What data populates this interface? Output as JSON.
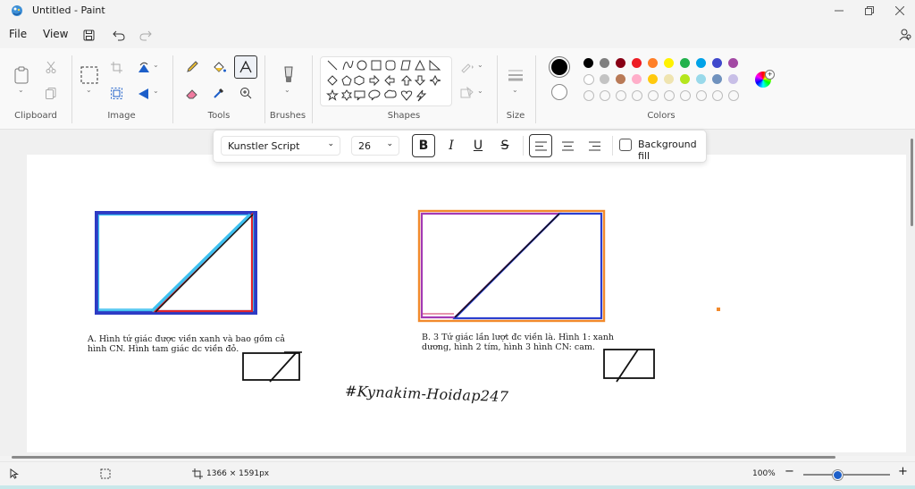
{
  "window": {
    "title": "Untitled - Paint"
  },
  "menu": {
    "file": "File",
    "view": "View"
  },
  "ribbon": {
    "groups": {
      "clipboard": "Clipboard",
      "image": "Image",
      "tools": "Tools",
      "brushes": "Brushes",
      "shapes": "Shapes",
      "size": "Size",
      "colors": "Colors"
    },
    "colors": {
      "row1": [
        "#000000",
        "#7f7f7f",
        "#880015",
        "#ed1c24",
        "#ff7f27",
        "#fff200",
        "#22b14c",
        "#00a2e8",
        "#3f48cc",
        "#a349a4"
      ],
      "row2": [
        "#ffffff",
        "#c3c3c3",
        "#b97a57",
        "#ffaec9",
        "#ffc90e",
        "#efe4b0",
        "#b5e61d",
        "#99d9ea",
        "#7092be",
        "#c8bfe7"
      ],
      "primary": "#000000",
      "secondary": "#ffffff"
    }
  },
  "textbar": {
    "font": "Kunstler Script",
    "size": "26",
    "bold": "B",
    "italic": "I",
    "underline": "U",
    "strike": "S",
    "background_fill": "Background fill"
  },
  "canvas": {
    "caption_a": "A. Hình tứ giác được viền xanh và bao gồm cả hình CN. Hình tam giác dc viền đỏ.",
    "caption_b": "B. 3 Tứ giác lần lượt đc viền là. Hình 1: xanh dương, hình 2 tím, hình 3 hình CN: cam.",
    "signature": "#Kynakim-Hoidap247",
    "shape_colors": {
      "blue": "#2b3fd0",
      "cyan": "#3ec1f0",
      "red": "#e0252d",
      "black": "#111111",
      "orange": "#f28a2c",
      "purple": "#a33bb5",
      "pink": "#d7557b"
    }
  },
  "status": {
    "dimensions": "1366 × 1591px",
    "zoom": "100%"
  }
}
